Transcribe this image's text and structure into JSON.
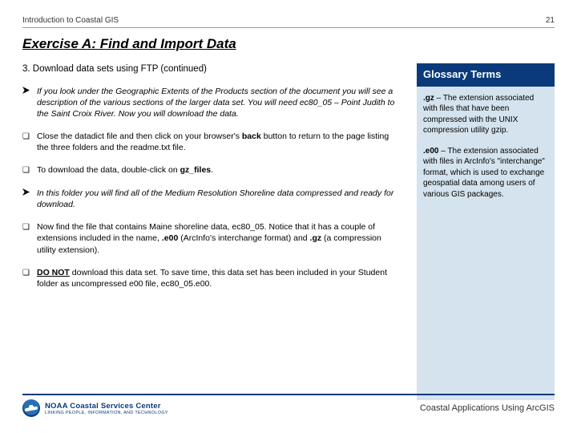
{
  "header": {
    "course": "Introduction to Coastal GIS",
    "page_number": "21"
  },
  "title": "Exercise A: Find and Import Data",
  "subhead": "3.  Download data sets using FTP (continued)",
  "items": [
    {
      "bullet": "arrow",
      "style": "italic",
      "text": "If you look under the Geographic Extents of the Products section of the document you will see a description of the various sections of the larger data set. You will need ec80_05 – Point Judith to the Saint Croix River. Now you will download the data."
    },
    {
      "bullet": "box",
      "pre": "Close the datadict file and then click on your browser's ",
      "bold1": "back",
      "post": " button to return to the page listing the three folders and the readme.txt file."
    },
    {
      "bullet": "box",
      "pre": "To download the data, double-click on ",
      "bold1": "gz_files",
      "post": "."
    },
    {
      "bullet": "arrow",
      "style": "italic",
      "text": "In this folder you will find all of the Medium Resolution Shoreline data compressed and ready for download."
    },
    {
      "bullet": "box",
      "pre": "Now find the file that contains Maine shoreline data, ec80_05. Notice that it has a couple of extensions included in the name, ",
      "bold1": ".e00",
      "mid": " (ArcInfo's interchange format) and ",
      "bold2": ".gz",
      "post": " (a compression utility extension)."
    },
    {
      "bullet": "box",
      "pre_underline_bold": "DO NOT",
      "post": " download this data set.  To save time, this data set has been included in your Student folder as uncompressed e00 file, ec80_05.e00."
    }
  ],
  "glossary": {
    "header": "Glossary Terms",
    "entries": [
      {
        "term": ".gz",
        "def": " – The extension associated with files that have been compressed with the UNIX compression utility gzip."
      },
      {
        "term": ".e00",
        "def": " – The extension associated with files in ArcInfo's \"interchange\" format, which is used to exchange geospatial data among users of various GIS packages."
      }
    ]
  },
  "footer": {
    "logo_line1": "NOAA Coastal Services Center",
    "logo_line2": "LINKING PEOPLE, INFORMATION, AND TECHNOLOGY",
    "text": "Coastal Applications Using ArcGIS"
  }
}
